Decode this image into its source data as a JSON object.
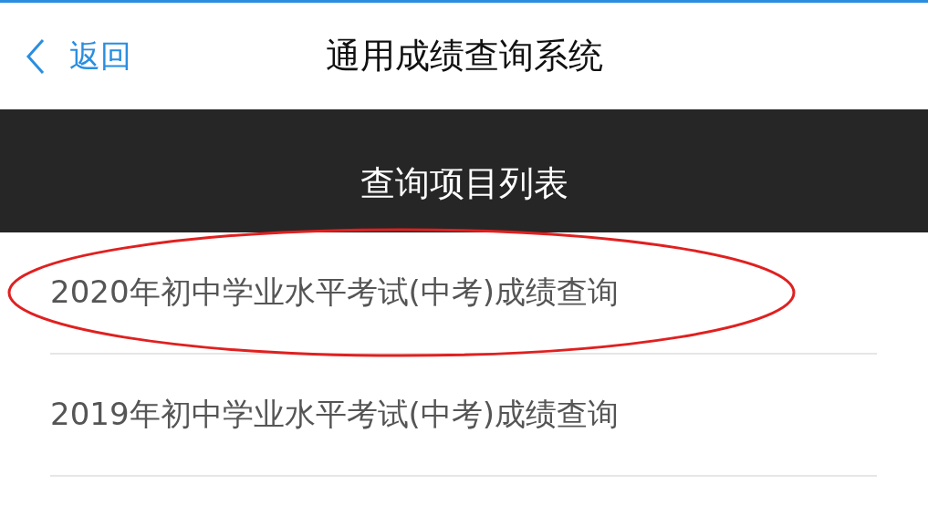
{
  "header": {
    "back_label": "返回",
    "title": "通用成绩查询系统"
  },
  "section": {
    "title": "查询项目列表"
  },
  "items": [
    {
      "label": "2020年初中学业水平考试(中考)成绩查询",
      "circled": true
    },
    {
      "label": "2019年初中学业水平考试(中考)成绩查询",
      "circled": false
    }
  ]
}
